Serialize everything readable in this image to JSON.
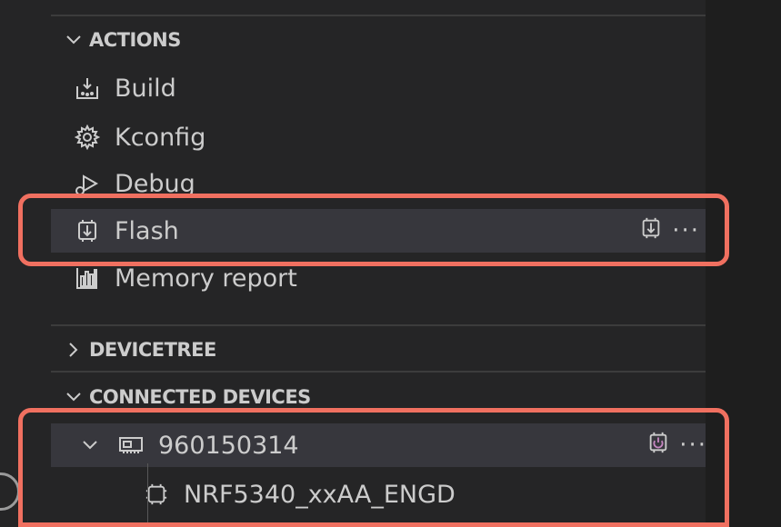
{
  "sections": {
    "actions": "ACTIONS",
    "devicetree": "DEVICETREE",
    "connected_devices": "CONNECTED DEVICES"
  },
  "actions": {
    "items": [
      {
        "label": "Build",
        "icon": "build-icon"
      },
      {
        "label": "Kconfig",
        "icon": "gear-icon"
      },
      {
        "label": "Debug",
        "icon": "debug-icon"
      },
      {
        "label": "Flash",
        "icon": "flash-icon"
      },
      {
        "label": "Memory report",
        "icon": "memory-report-icon"
      }
    ]
  },
  "devices": {
    "serial": "960150314",
    "chip": "NRF5340_xxAA_ENGD"
  },
  "colors": {
    "highlight": "#f07060",
    "panel_bg": "#252526",
    "selected_bg": "#37373d",
    "text": "#cccccc"
  }
}
